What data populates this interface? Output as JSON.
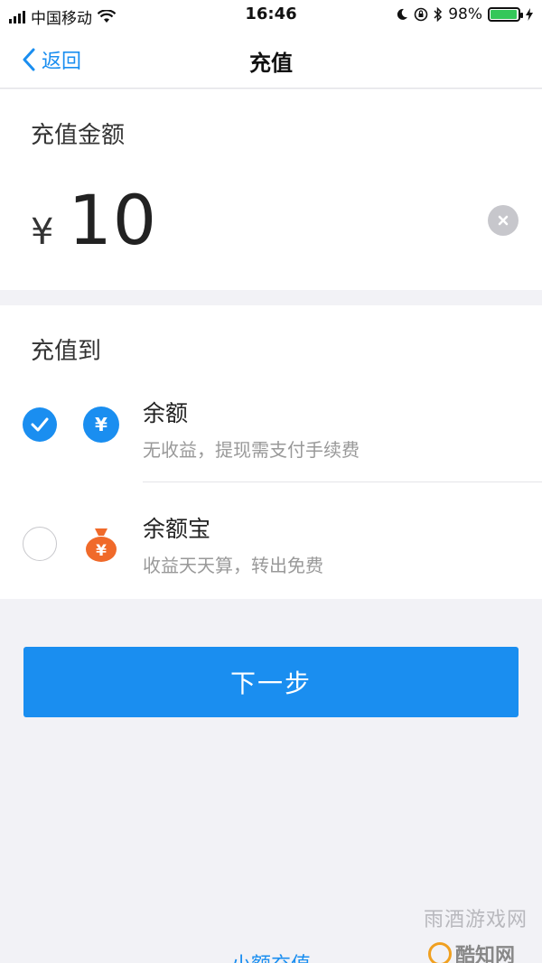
{
  "status_bar": {
    "carrier": "中国移动",
    "time": "16:46",
    "battery": "98%",
    "battery_level": 0.98
  },
  "nav": {
    "back_label": "返回",
    "title": "充值"
  },
  "amount": {
    "label": "充值金额",
    "currency": "¥",
    "value": "10"
  },
  "target": {
    "label": "充值到",
    "options": [
      {
        "title": "余额",
        "subtitle": "无收益，提现需支付手续费",
        "selected": true,
        "icon": "yen-circle-icon",
        "icon_color": "#1a8ef0"
      },
      {
        "title": "余额宝",
        "subtitle": "收益天天算，转出免费",
        "selected": false,
        "icon": "money-bag-icon",
        "icon_color": "#f06a2a"
      }
    ]
  },
  "next_button": "下一步",
  "bottom_link": "小额充值",
  "watermark": {
    "text": "雨酒游戏网",
    "logo_text": "酷知网"
  },
  "colors": {
    "accent": "#1a8ef0",
    "background": "#f2f2f6"
  }
}
